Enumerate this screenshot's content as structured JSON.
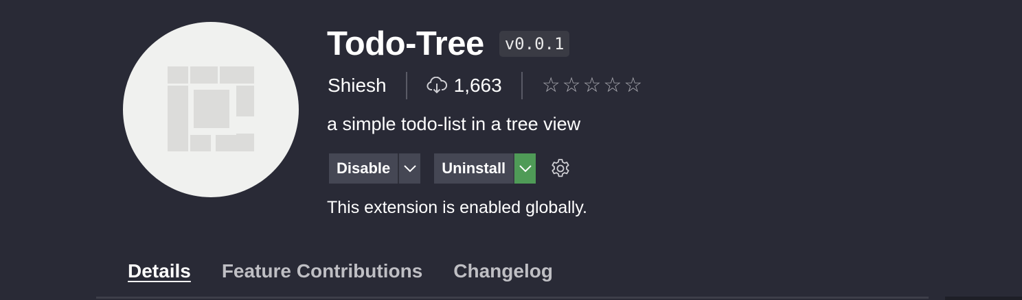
{
  "extension": {
    "name": "Todo-Tree",
    "version": "v0.0.1",
    "publisher": "Shiesh",
    "installs": "1,663",
    "rating_stars": [
      "☆",
      "☆",
      "☆",
      "☆",
      "☆"
    ],
    "description": "a simple todo-list in a tree view",
    "status": "This extension is enabled globally.",
    "logo_icon": "todo-tree-logo"
  },
  "actions": {
    "disable_label": "Disable",
    "uninstall_label": "Uninstall"
  },
  "tabs": [
    {
      "label": "Details",
      "active": true
    },
    {
      "label": "Feature Contributions",
      "active": false
    },
    {
      "label": "Changelog",
      "active": false
    }
  ],
  "colors": {
    "background": "#292a36",
    "button": "#454754",
    "accent_green": "#4f9b57"
  }
}
